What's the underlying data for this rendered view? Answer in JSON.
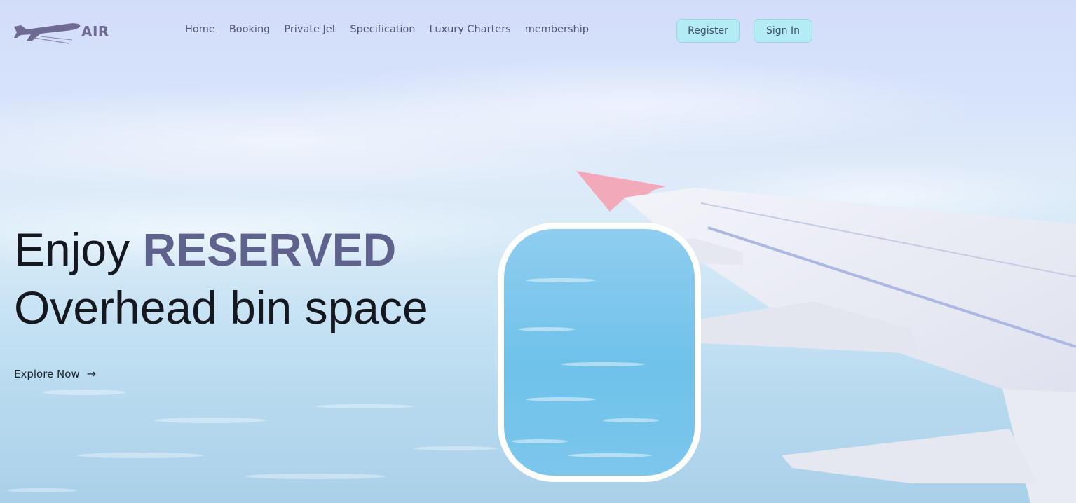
{
  "brand": {
    "name": "AIR",
    "logo_icon": "airplane-icon"
  },
  "nav": {
    "items": [
      {
        "label": "Home"
      },
      {
        "label": "Booking"
      },
      {
        "label": "Private Jet"
      },
      {
        "label": "Specification"
      },
      {
        "label": "Luxury Charters"
      },
      {
        "label": "membership"
      }
    ]
  },
  "auth": {
    "register_label": "Register",
    "signin_label": "Sign In"
  },
  "hero": {
    "prefix": "Enjoy ",
    "accent": "RESERVED",
    "line2": "Overhead bin space",
    "cta_label": "Explore Now",
    "cta_icon": "arrow-right-icon"
  },
  "colors": {
    "accent": "#60628e",
    "button_bg": "#b3edf3",
    "nav_text": "#535678"
  }
}
